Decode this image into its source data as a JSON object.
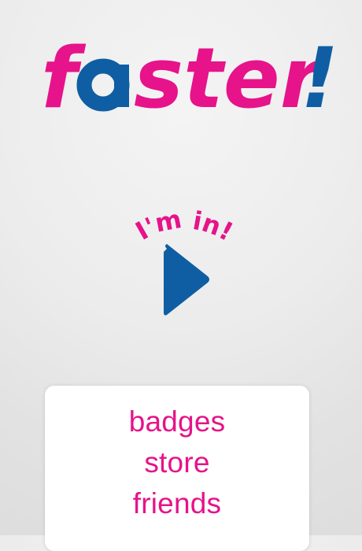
{
  "app": {
    "logo_prefix": "f",
    "logo_a": "a",
    "logo_rest": "ster",
    "logo_bang": "!"
  },
  "play": {
    "label": "I'm in!",
    "icon": "play-triangle-icon"
  },
  "menu": {
    "items": [
      {
        "label": "badges"
      },
      {
        "label": "store"
      },
      {
        "label": "friends"
      }
    ]
  },
  "colors": {
    "brand_pink": "#e6138a",
    "brand_blue": "#0f5ea3",
    "background": "#e9e9e9",
    "card": "#ffffff"
  }
}
